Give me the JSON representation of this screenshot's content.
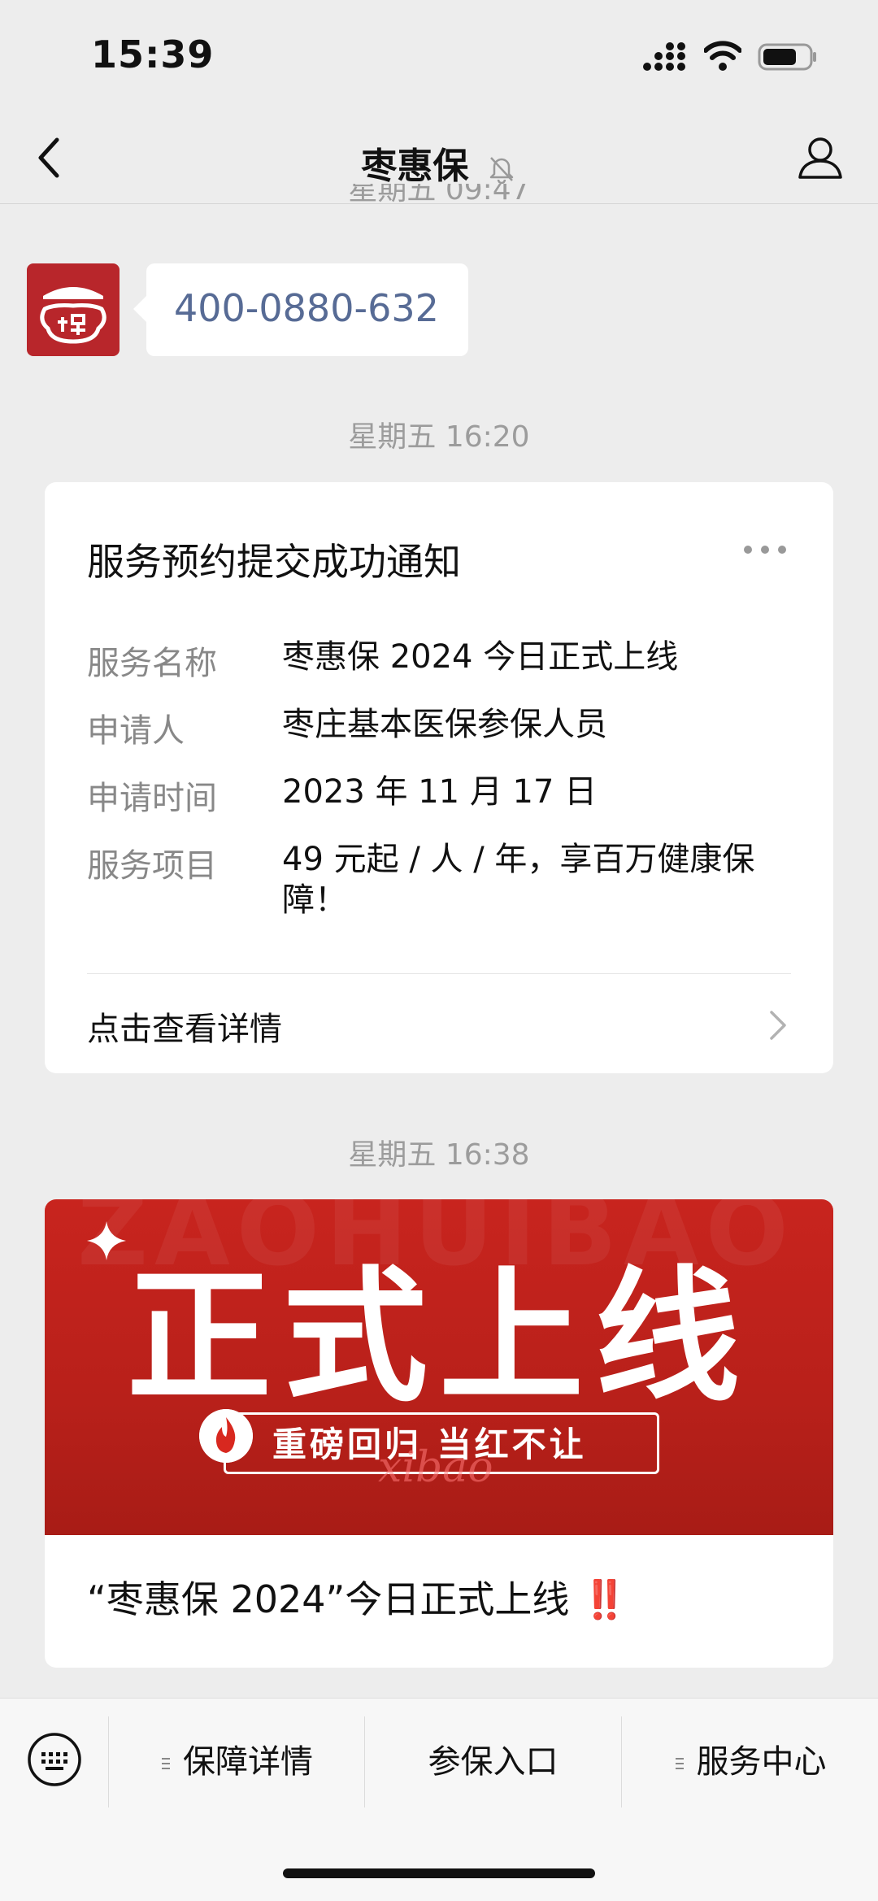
{
  "status_bar": {
    "time": "15:39"
  },
  "header": {
    "title": "枣惠保"
  },
  "messages": {
    "cut_timestamp": "星期五 09:47",
    "phone_number": "400-0880-632",
    "timestamp_1": "星期五 16:20",
    "timestamp_2": "星期五 16:38"
  },
  "service_card": {
    "title": "服务预约提交成功通知",
    "fields": [
      {
        "label": "服务名称",
        "value": "枣惠保 2024 今日正式上线"
      },
      {
        "label": "申请人",
        "value": "枣庄基本医保参保人员"
      },
      {
        "label": "申请时间",
        "value": "2023 年 11 月 17 日"
      },
      {
        "label": "服务项目",
        "value": "49 元起 / 人 / 年，享百万健康保障！"
      }
    ],
    "link_label": "点击查看详情"
  },
  "article_card": {
    "banner_bg_text": "ZAOHUIBAO",
    "banner_headline": "正式上线",
    "banner_tag": "重磅回归 当红不让",
    "banner_script": "xibao",
    "title": "“枣惠保 2024”今日正式上线",
    "title_suffix": "‼️"
  },
  "bottom_menu": {
    "items": [
      {
        "label": "保障详情",
        "has_submenu": true
      },
      {
        "label": "参保入口",
        "has_submenu": false
      },
      {
        "label": "服务中心",
        "has_submenu": true
      }
    ]
  },
  "colors": {
    "brand_red": "#b8262b",
    "link_blue": "#576b95",
    "background": "#ededed"
  }
}
